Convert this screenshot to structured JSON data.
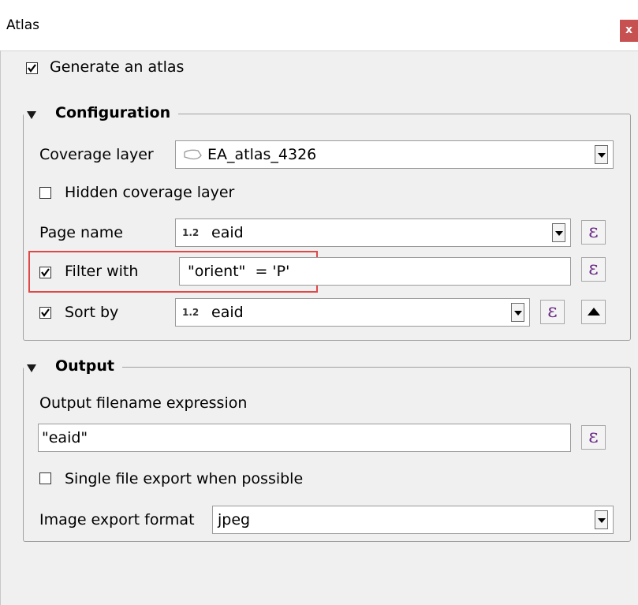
{
  "window": {
    "title": "Atlas",
    "close_label": "x"
  },
  "generate_atlas": {
    "label": "Generate an atlas",
    "checked": true
  },
  "configuration": {
    "title": "Configuration",
    "coverage_layer": {
      "label": "Coverage layer",
      "value": "EA_atlas_4326",
      "icon": "polygon-layer-icon"
    },
    "hidden_coverage": {
      "label": "Hidden coverage layer",
      "checked": false
    },
    "page_name": {
      "label": "Page name",
      "type_badge": "1.2",
      "value": "eaid"
    },
    "filter_with": {
      "label": "Filter with",
      "checked": true,
      "value": "\"orient\"  = 'P'"
    },
    "sort_by": {
      "label": "Sort by",
      "checked": true,
      "type_badge": "1.2",
      "value": "eaid"
    }
  },
  "output": {
    "title": "Output",
    "filename_label": "Output filename expression",
    "filename_value": "\"eaid\"",
    "single_file": {
      "label": "Single file export when possible",
      "checked": false
    },
    "image_format_label": "Image export format",
    "image_format_value": "jpeg"
  },
  "expression_button_glyph": "ε",
  "colors": {
    "highlight": "#e04848",
    "close_button": "#c75050",
    "expression_icon": "#6a2a86"
  }
}
